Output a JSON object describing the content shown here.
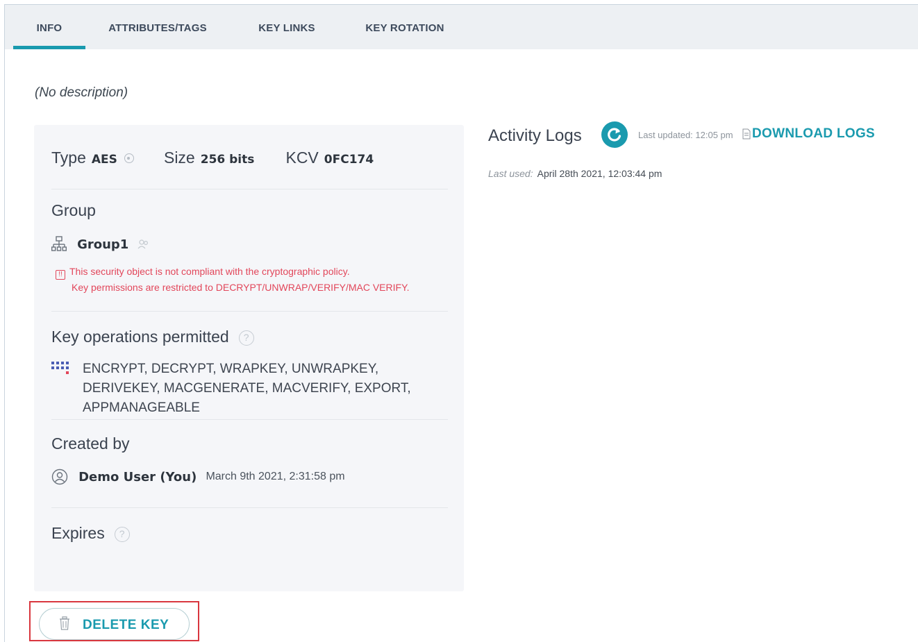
{
  "tabs": [
    {
      "label": "INFO",
      "active": true
    },
    {
      "label": "ATTRIBUTES/TAGS",
      "active": false
    },
    {
      "label": "KEY LINKS",
      "active": false
    },
    {
      "label": "KEY ROTATION",
      "active": false
    }
  ],
  "description": "(No description)",
  "key_info": {
    "type_label": "Type",
    "type_value": "AES",
    "size_label": "Size",
    "size_value": "256 bits",
    "kcv_label": "KCV",
    "kcv_value": "0FC174"
  },
  "group": {
    "title": "Group",
    "name": "Group1",
    "warning_line1": "This security object is not compliant with the cryptographic policy.",
    "warning_line2": "Key permissions are restricted to DECRYPT/UNWRAP/VERIFY/MAC VERIFY."
  },
  "key_operations": {
    "title": "Key operations permitted",
    "help_glyph": "?",
    "operations": "ENCRYPT, DECRYPT, WRAPKEY, UNWRAPKEY, DERIVEKEY, MACGENERATE, MACVERIFY, EXPORT, APPMANAGEABLE"
  },
  "created_by": {
    "title": "Created by",
    "user": "Demo User (You)",
    "date": "March 9th 2021, 2:31:58 pm"
  },
  "expires": {
    "title": "Expires",
    "help_glyph": "?"
  },
  "activity_logs": {
    "title": "Activity Logs",
    "last_updated": "Last updated: 12:05 pm",
    "download_label": "DOWNLOAD LOGS",
    "last_used_label": "Last used:",
    "last_used_value": "April 28th 2021, 12:03:44 pm"
  },
  "actions": {
    "delete_label": "DELETE KEY"
  },
  "colors": {
    "accent": "#1a9aae",
    "warning": "#e2465a",
    "highlight_outline": "#d9363e"
  }
}
